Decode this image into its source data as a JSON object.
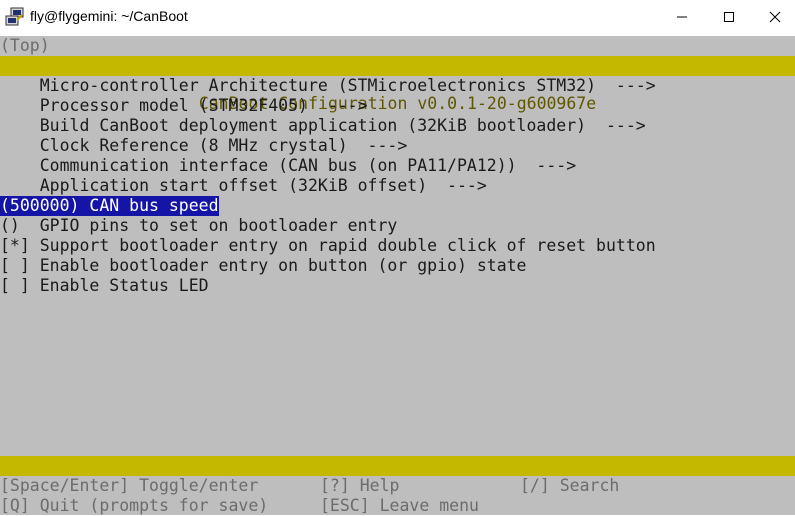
{
  "window": {
    "title": "fly@flygemini: ~/CanBoot",
    "minimize_icon": "minimize-icon",
    "maximize_icon": "maximize-icon",
    "close_icon": "close-icon"
  },
  "menu": {
    "breadcrumb": "(Top)",
    "header": "CanBoot Configuration v0.0.1-20-g600967e",
    "items": [
      {
        "label": "    Micro-controller Architecture (STMicroelectronics STM32)  --->"
      },
      {
        "label": "    Processor model (STM32F405)  --->"
      },
      {
        "label": "    Build CanBoot deployment application (32KiB bootloader)  --->"
      },
      {
        "label": "    Clock Reference (8 MHz crystal)  --->"
      },
      {
        "label": "    Communication interface (CAN bus (on PA11/PA12))  --->"
      },
      {
        "label": "    Application start offset (32KiB offset)  --->"
      },
      {
        "label": "(500000) CAN bus speed",
        "selected": true
      },
      {
        "label": "()  GPIO pins to set on bootloader entry"
      },
      {
        "label": "[*] Support bootloader entry on rapid double click of reset button"
      },
      {
        "label": "[ ] Enable bootloader entry on button (or gpio) state"
      },
      {
        "label": "[ ] Enable Status LED"
      }
    ]
  },
  "help": {
    "toggle": "[Space/Enter] Toggle/enter",
    "help": "[?] Help",
    "search": "[/] Search",
    "quit": "[Q] Quit (prompts for save)",
    "leave": "[ESC] Leave menu"
  },
  "colors": {
    "terminal_bg": "#bebebe",
    "bar": "#c4b800",
    "selection": "#1414a6"
  }
}
